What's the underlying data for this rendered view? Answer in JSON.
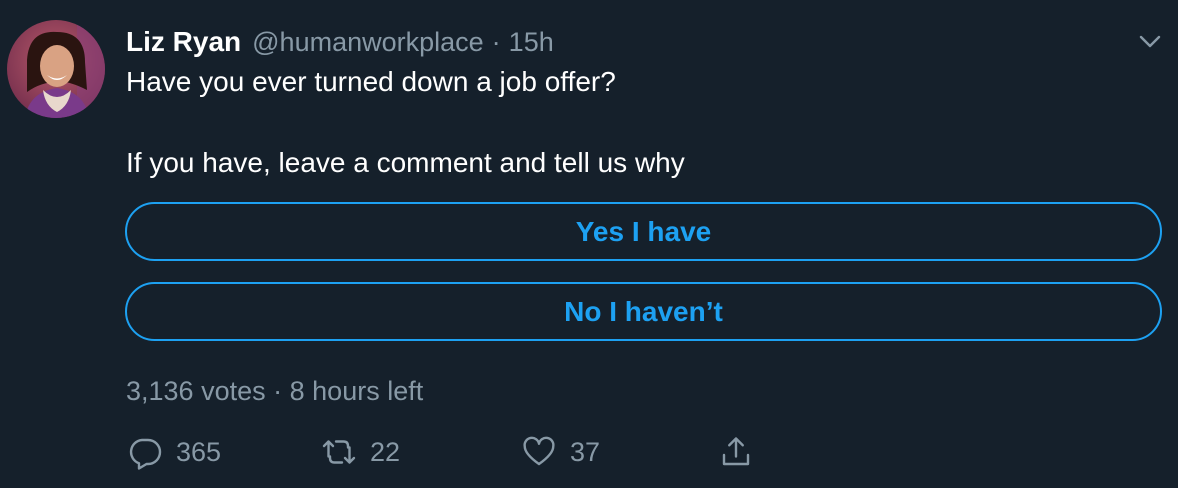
{
  "tweet": {
    "author_name": "Liz Ryan",
    "author_handle": "@humanworkplace",
    "separator": "·",
    "time_ago": "15h",
    "text_line1": "Have you ever turned down a job offer?",
    "text_line2": "If you have, leave a comment and tell us why"
  },
  "poll": {
    "options": [
      {
        "label": "Yes I have"
      },
      {
        "label": "No I haven’t"
      }
    ],
    "votes": "3,136 votes",
    "separator": "·",
    "time_left": "8 hours left"
  },
  "actions": {
    "replies": "365",
    "retweets": "22",
    "likes": "37"
  },
  "icons": {
    "avatar": "profile-photo",
    "caret": "chevron-down-icon",
    "reply": "reply-icon",
    "retweet": "retweet-icon",
    "like": "heart-icon",
    "share": "share-icon"
  },
  "colors": {
    "background": "#15202b",
    "accent": "#1da1f2",
    "secondary_text": "#8899a6",
    "primary_text": "#ffffff"
  }
}
